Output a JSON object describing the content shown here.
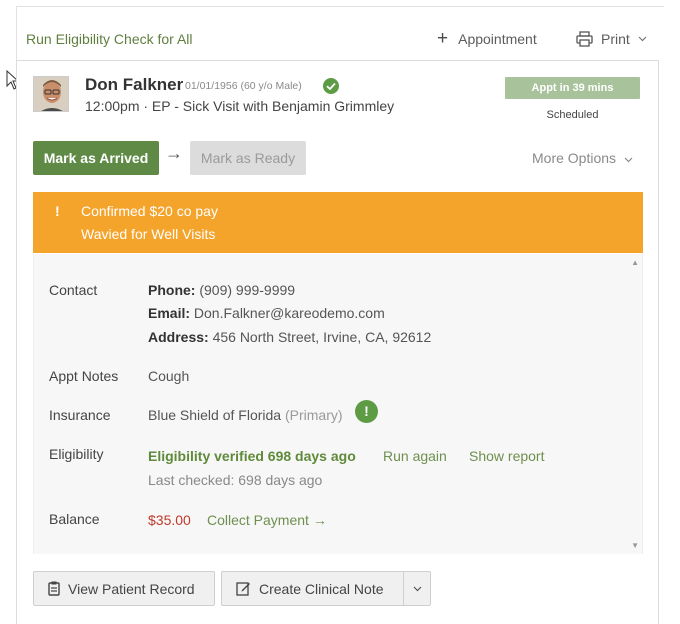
{
  "toolbar": {
    "run_eligibility": "Run Eligibility Check for All",
    "appointment_label": "Appointment",
    "print_label": "Print"
  },
  "patient": {
    "name": "Don Falkner",
    "meta": "01/01/1956 (60 y/o Male)",
    "appointment": "12:00pm · EP - Sick Visit with Benjamin Grimmley",
    "appt_badge": "Appt in 39 mins",
    "status": "Scheduled"
  },
  "actions": {
    "mark_arrived": "Mark as Arrived",
    "flow_arrow": "→",
    "mark_ready": "Mark as Ready",
    "more_options": "More Options"
  },
  "alert": {
    "bang": "!",
    "line1": "Confirmed $20 co pay",
    "line2": "Wavied for Well Visits"
  },
  "details": {
    "contact_label": "Contact",
    "phone_label": "Phone:",
    "phone": "(909) 999-9999",
    "email_label": "Email:",
    "email": "Don.Falkner@kareodemo.com",
    "address_label": "Address:",
    "address": "456 North Street, Irvine, CA, 92612",
    "notes_label": "Appt Notes",
    "notes": "Cough",
    "insurance_label": "Insurance",
    "insurance": "Blue Shield of Florida",
    "insurance_type": "(Primary)",
    "insurance_warn": "!",
    "eligibility_label": "Eligibility",
    "eligibility_status": "Eligibility verified 698 days ago",
    "run_again": "Run again",
    "show_report": "Show report",
    "last_checked": "Last checked: 698 days ago",
    "balance_label": "Balance",
    "balance": "$35.00",
    "collect_payment": "Collect Payment →"
  },
  "footer": {
    "view_record": "View Patient Record",
    "create_note": "Create Clinical Note"
  },
  "colors": {
    "primary_green": "#5e8a45",
    "link_green": "#6f8f4f",
    "alert_orange": "#f5a42b",
    "badge_green": "#a8c39b",
    "balance_red": "#c0392b"
  }
}
